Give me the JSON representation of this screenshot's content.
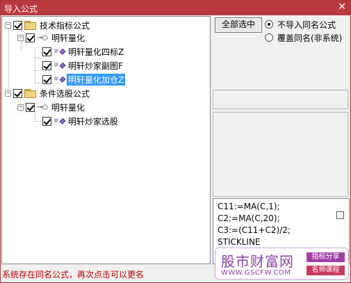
{
  "window": {
    "title": "导入公式",
    "close": "✕"
  },
  "tree": [
    {
      "label": "技术指标公式",
      "type": "folder"
    },
    {
      "label": "明轩量化",
      "type": "group"
    },
    {
      "label": "明轩量化四标Z",
      "type": "formula"
    },
    {
      "label": "明轩炒家副图F",
      "type": "formula"
    },
    {
      "label": "明轩量化加仓Z",
      "type": "formula",
      "selected": true
    },
    {
      "label": "条件选股公式",
      "type": "folder"
    },
    {
      "label": "明轩量化",
      "type": "group"
    },
    {
      "label": "明轩炒家选股",
      "type": "formula"
    }
  ],
  "tree_expander": "−",
  "buttons": {
    "select_all": "全部选中"
  },
  "options": [
    {
      "label": "不导入同名公式",
      "selected": true
    },
    {
      "label": "覆盖同名(非系统)",
      "selected": false
    }
  ],
  "code_lines": [
    "C11:=MA(C,1);",
    "C2:=MA(C,20);",
    "C3:=(C11+C2)/2;",
    "STICKLINE"
  ],
  "status": "系统存在同名公式，再次点击可以更名",
  "watermark": {
    "brand": "股市财富网",
    "url": "WWW.GSCFW.COM",
    "tag1": "指标分享",
    "tag2": "名师课程"
  },
  "colors": {
    "titlebar": "#b83a3f",
    "selection": "#3399ff",
    "status": "#c00000"
  }
}
